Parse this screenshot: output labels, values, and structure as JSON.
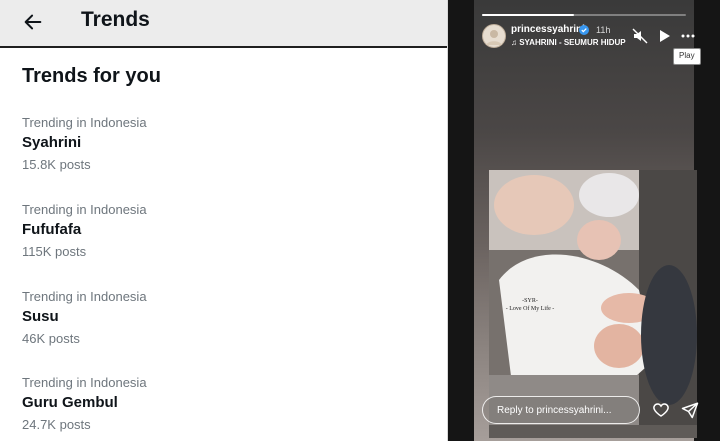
{
  "trends_panel": {
    "header_title": "Trends",
    "section_title": "Trends for you",
    "trends": [
      {
        "context": "Trending in Indonesia",
        "name": "Syahrini",
        "posts": "15.8K posts"
      },
      {
        "context": "Trending in Indonesia",
        "name": "Fufufafa",
        "posts": "115K posts"
      },
      {
        "context": "Trending in Indonesia",
        "name": "Susu",
        "posts": "46K posts"
      },
      {
        "context": "Trending in Indonesia",
        "name": "Guru Gembul",
        "posts": "24.7K posts"
      }
    ]
  },
  "story": {
    "username": "princessyahrini",
    "time": "11h",
    "music": "♫ SYAHRINI - SEUMUR HIDUP",
    "tooltip": "Play",
    "caption_line1": "-SYR-",
    "caption_line2": "- Love Of My Life -",
    "reply_placeholder": "Reply to princessyahrini...",
    "progress_fraction": 0.45
  },
  "icons": {
    "back": "back-arrow-icon",
    "verified": "verified-icon",
    "mute": "mute-icon",
    "play": "play-icon",
    "more": "more-icon",
    "like": "heart-icon",
    "share": "send-icon"
  },
  "colors": {
    "text_primary": "#0f1419",
    "text_secondary": "#6e767d",
    "verified_blue": "#3897f0"
  }
}
